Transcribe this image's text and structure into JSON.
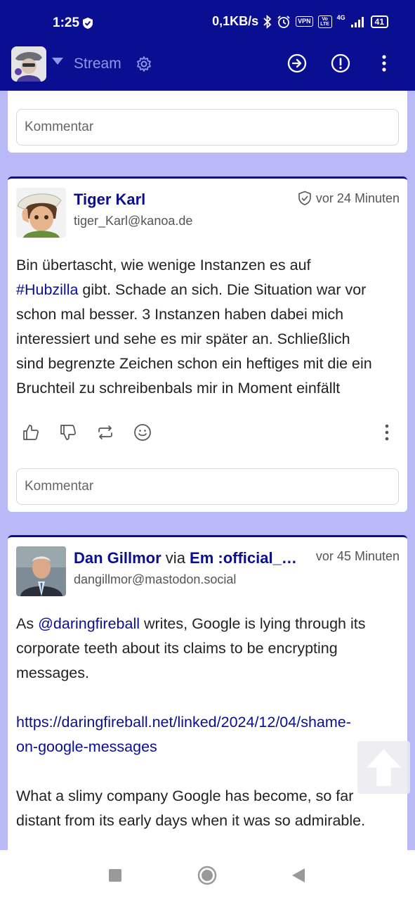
{
  "status_bar": {
    "time": "1:25",
    "net_speed": "0,1KB/s",
    "vpn": "VPN",
    "volte": "Vo LTE",
    "network": "4G",
    "battery": "41"
  },
  "app_bar": {
    "title": "Stream",
    "icons": [
      "gear-icon",
      "arrow-right-circle-icon",
      "alert-circle-icon",
      "more-vert-icon"
    ]
  },
  "top_card": {
    "comment_placeholder": "Kommentar"
  },
  "posts": [
    {
      "author": "Tiger Karl",
      "handle": "tiger_Karl@kanoa.de",
      "time": "vor 24 Minuten",
      "body_lines": [
        {
          "text": "Bin übertascht, wie wenige Instanzen es auf"
        },
        {
          "link": "#Hubzilla",
          "text": " gibt. Schade an sich. Die Situation war vor"
        },
        {
          "text": "schon mal besser. 3 Instanzen haben dabei mich"
        },
        {
          "text": "interessiert und sehe es mir später an. Schließlich"
        },
        {
          "text": "sind begrenzte Zeichen schon ein heftiges mit die ein"
        },
        {
          "text": "Bruchteil zu schreibenbals mir in Moment einfällt"
        }
      ],
      "comment_placeholder": "Kommentar"
    },
    {
      "author": "Dan Gillmor",
      "via_label": " via ",
      "via_name": "Em :official_ve…",
      "handle": "dangillmor@mastodon.social",
      "time": "vor 45 Minuten",
      "paragraph1": {
        "prefix": "As ",
        "mention": "@daringfireball",
        "rest_line1": " writes, Google is lying through its",
        "line2": "corporate teeth about its claims to be encrypting",
        "line3": "messages."
      },
      "link_line1": "https://daringfireball.net/linked/2024/12/04/shame-",
      "link_line2": "on-google-messages",
      "paragraph3_line1": "What a slimy company Google has become, so far",
      "paragraph3_line2": "distant from its early days when it was so admirable."
    }
  ],
  "colors": {
    "brand": "#0a0f91",
    "background": "#b9b9f7",
    "accent_light": "#8a9ae8"
  }
}
